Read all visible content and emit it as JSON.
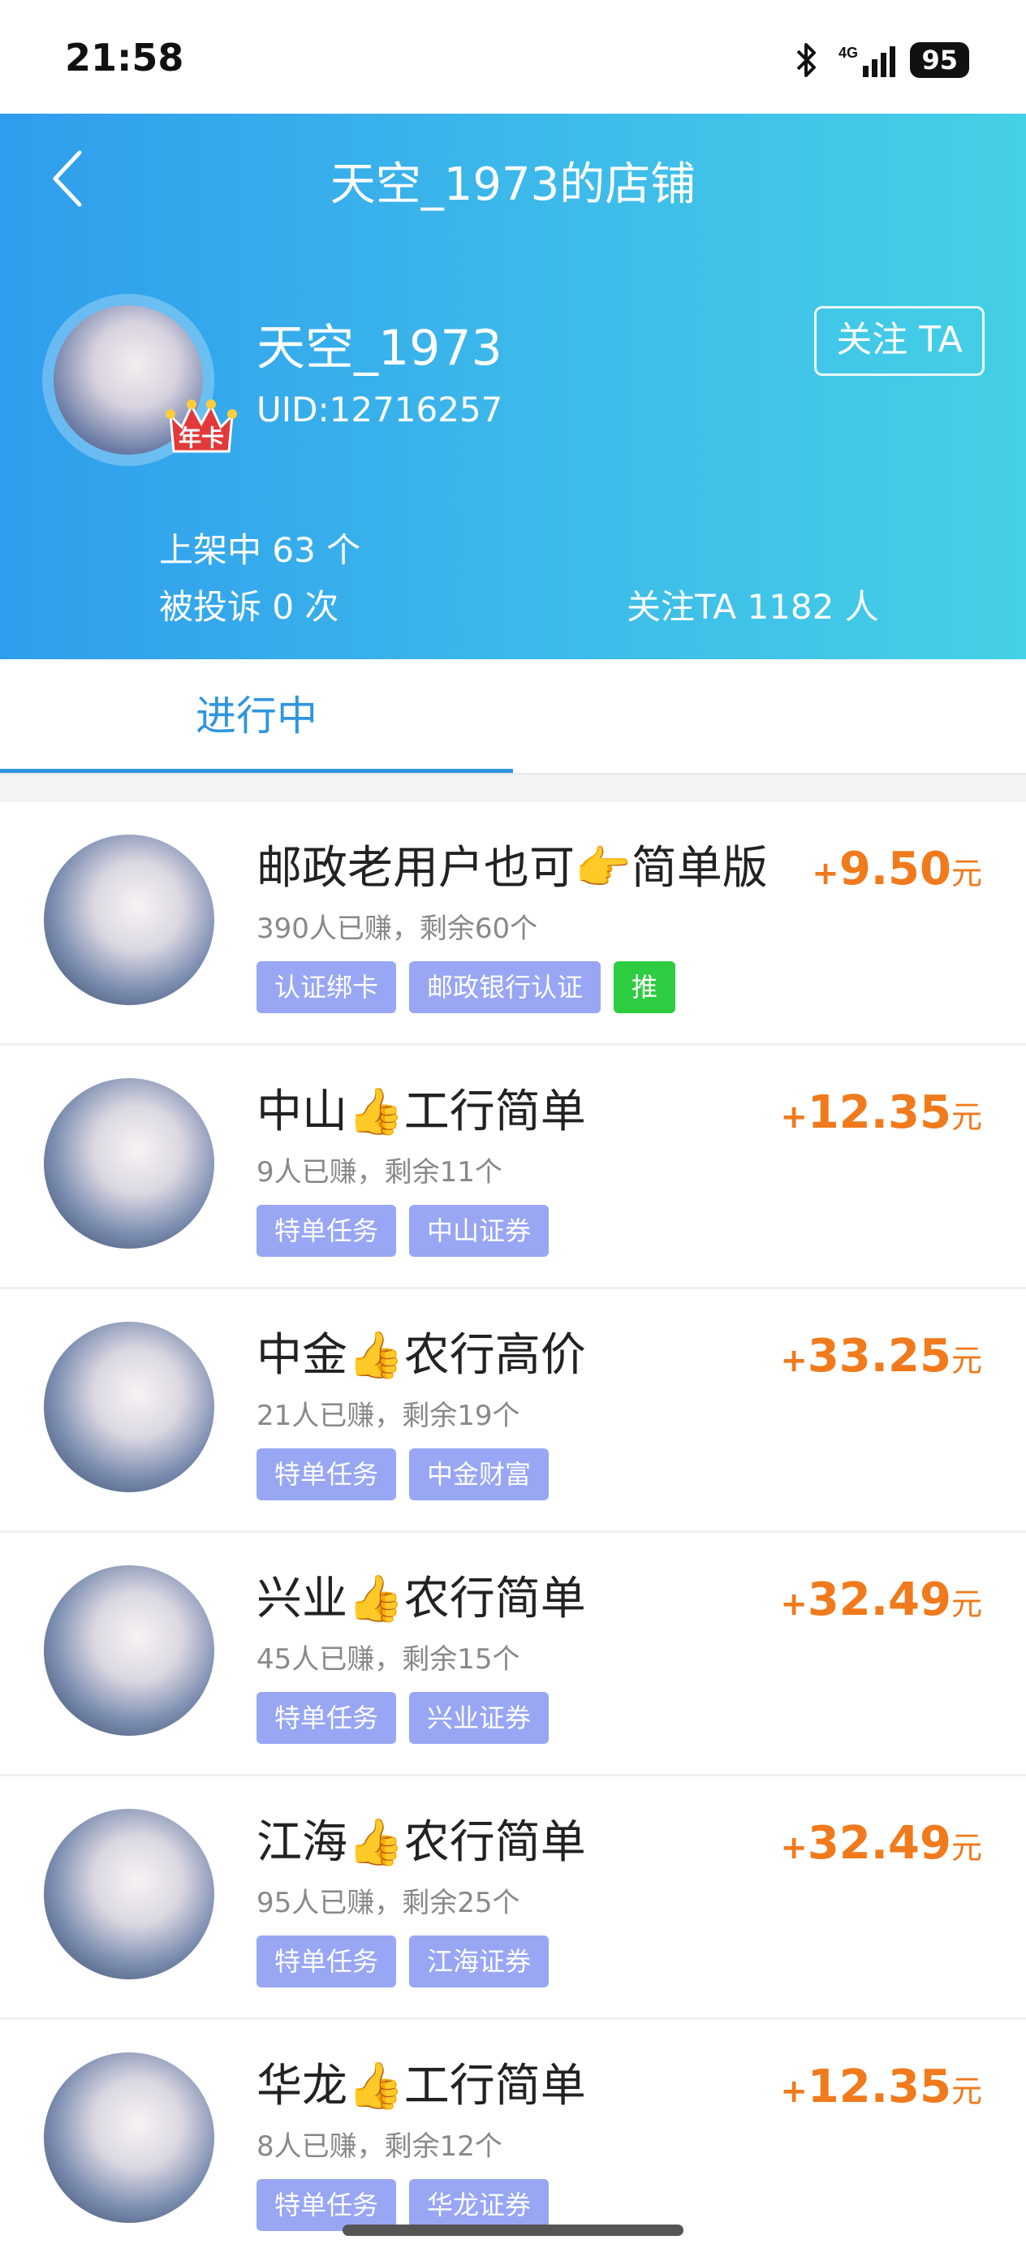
{
  "status_bar": {
    "time": "21:58",
    "network": "4G",
    "battery": "95"
  },
  "header": {
    "title": "天空_1973的店铺",
    "username": "天空_1973",
    "uid": "UID:12716257",
    "badge": "年卡",
    "follow_button": "关注 TA",
    "listed": "上架中 63 个",
    "complaints": "被投诉 0 次",
    "followers": "关注TA 1182 人"
  },
  "tabs": {
    "active": "进行中"
  },
  "items": [
    {
      "title": "邮政老用户也可👉简单版",
      "stats": "390人已赚，剩余60个",
      "plus": "+",
      "price": "9.50",
      "unit": "元",
      "tags": [
        "认证绑卡",
        "邮政银行认证"
      ],
      "promo": "推"
    },
    {
      "title": "中山👍工行简单",
      "stats": "9人已赚，剩余11个",
      "plus": "+",
      "price": "12.35",
      "unit": "元",
      "tags": [
        "特单任务",
        "中山证券"
      ]
    },
    {
      "title": "中金👍农行高价",
      "stats": "21人已赚，剩余19个",
      "plus": "+",
      "price": "33.25",
      "unit": "元",
      "tags": [
        "特单任务",
        "中金财富"
      ]
    },
    {
      "title": "兴业👍农行简单",
      "stats": "45人已赚，剩余15个",
      "plus": "+",
      "price": "32.49",
      "unit": "元",
      "tags": [
        "特单任务",
        "兴业证券"
      ]
    },
    {
      "title": "江海👍农行简单",
      "stats": "95人已赚，剩余25个",
      "plus": "+",
      "price": "32.49",
      "unit": "元",
      "tags": [
        "特单任务",
        "江海证券"
      ]
    },
    {
      "title": "华龙👍工行简单",
      "stats": "8人已赚，剩余12个",
      "plus": "+",
      "price": "12.35",
      "unit": "元",
      "tags": [
        "特单任务",
        "华龙证券"
      ]
    }
  ],
  "colors": {
    "accent": "#2f95e0",
    "price": "#f07a1c",
    "tag": "#98a6f4",
    "promo": "#2ecc40"
  }
}
